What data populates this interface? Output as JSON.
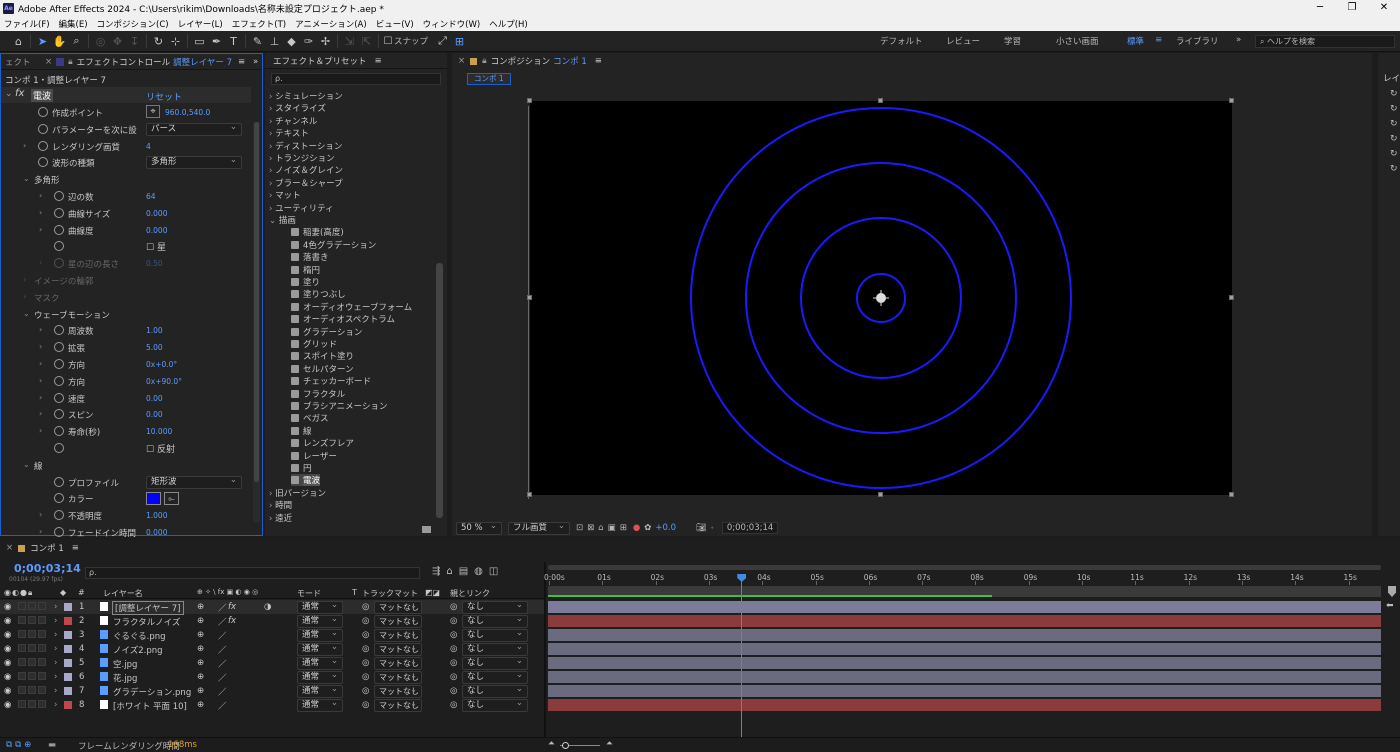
{
  "window": {
    "title": "Adobe After Effects 2024 - C:\\Users\\rikim\\Downloads\\名称未設定プロジェクト.aep *",
    "minimize": "─",
    "maximize": "❐",
    "close": "✕"
  },
  "menu": [
    "ファイル(F)",
    "編集(E)",
    "コンポジション(C)",
    "レイヤー(L)",
    "エフェクト(T)",
    "アニメーション(A)",
    "ビュー(V)",
    "ウィンドウ(W)",
    "ヘルプ(H)"
  ],
  "toolbar": {
    "snap_label": "スナップ",
    "workspaces": [
      "デフォルト",
      "レビュー",
      "学習",
      "小さい画面",
      "標準",
      "ライブラリ"
    ],
    "active_workspace": "標準",
    "more": "»",
    "help_placeholder": "ヘルプを検索"
  },
  "effect_controls": {
    "left_tab": "ェクト",
    "tab_prefix": "エフェクトコントロール",
    "tab_layer": "調整レイヤー 7",
    "menu_icon": "≡",
    "more": "»",
    "breadcrumb": "コンポ 1・調整レイヤー 7",
    "effect_name": "電波",
    "reset": "リセット",
    "rows": [
      {
        "label": "作成ポイント",
        "value": "960.0,540.0"
      },
      {
        "label": "パラメーターを次に設",
        "dropdown": "パース"
      },
      {
        "label": "レンダリング画質",
        "value": "4"
      },
      {
        "label": "波形の種類",
        "dropdown": "多角形"
      },
      {
        "label": "多角形",
        "group": true
      },
      {
        "label": "辺の数",
        "value": "64"
      },
      {
        "label": "曲線サイズ",
        "value": "0.000"
      },
      {
        "label": "曲線度",
        "value": "0.000"
      },
      {
        "label": "",
        "checkbox": "星"
      },
      {
        "label": "星の辺の長さ",
        "value": "0.50",
        "disabled": true
      },
      {
        "label": "イメージの輪郭",
        "group": true,
        "disabled": true
      },
      {
        "label": "マスク",
        "group": true,
        "disabled": true
      },
      {
        "label": "ウェーブモーション",
        "group": true
      },
      {
        "label": "周波数",
        "value": "1.00"
      },
      {
        "label": "拡張",
        "value": "5.00"
      },
      {
        "label": "方向",
        "value": "0x+0.0°"
      },
      {
        "label": "方向",
        "value": "0x+90.0°"
      },
      {
        "label": "速度",
        "value": "0.00"
      },
      {
        "label": "スピン",
        "value": "0.00"
      },
      {
        "label": "寿命(秒)",
        "value": "10.000"
      },
      {
        "label": "",
        "checkbox": "反射"
      },
      {
        "label": "線",
        "group": true
      },
      {
        "label": "プロファイル",
        "dropdown": "矩形波"
      },
      {
        "label": "カラー",
        "color": "#0000ff"
      },
      {
        "label": "不透明度",
        "value": "1.000"
      },
      {
        "label": "フェードイン時間",
        "value": "0.000"
      }
    ]
  },
  "effects_presets": {
    "tab": "エフェクト＆プリセット",
    "menu_icon": "≡",
    "search_placeholder": "ρ.",
    "categories_before": [
      "シミュレーション",
      "スタイライズ",
      "チャンネル",
      "テキスト",
      "ディストーション",
      "トランジション",
      "ノイズ＆グレイン",
      "ブラー＆シャープ",
      "マット",
      "ユーティリティ"
    ],
    "open_category": "描画",
    "items": [
      "稲妻(高度)",
      "4色グラデーション",
      "落書き",
      "楕円",
      "塗り",
      "塗りつぶし",
      "オーディオウェーブフォーム",
      "オーディオスペクトラム",
      "グラデーション",
      "グリッド",
      "スポイト塗り",
      "セルパターン",
      "チェッカーボード",
      "フラクタル",
      "ブラシアニメーション",
      "ベガス",
      "線",
      "レンズフレア",
      "レーザー",
      "円",
      "電波"
    ],
    "selected_item": "電波",
    "categories_after": [
      "旧バージョン",
      "時間",
      "遠近"
    ]
  },
  "composition": {
    "tab_prefix": "コンポジション",
    "tab_name": "コンポ 1",
    "menu_icon": "≡",
    "subtab": "コンポ 1",
    "ring_color": "#1a1aff",
    "zoom": "50 %",
    "resolution": "フル画質",
    "exposure": "+0.0",
    "timecode": "0;00;03;14"
  },
  "timeline": {
    "tab": "コンポ 1",
    "menu_icon": "≡",
    "timecode": "0;00;03;14",
    "frame_info": "00104 (29.97 fps)",
    "search_placeholder": "ρ.",
    "col_num": "#",
    "col_layer_name": "レイヤー名",
    "col_switches": "⊕ ✧ \\ fx ▣ ◐ ◉ ◎",
    "col_mode": "モード",
    "col_t": "T",
    "col_trackmatte": "トラックマット",
    "col_parent": "親とリンク",
    "ruler": [
      "0:00s",
      "01s",
      "02s",
      "03s",
      "04s",
      "05s",
      "06s",
      "07s",
      "08s",
      "09s",
      "10s",
      "11s",
      "12s",
      "13s",
      "14s",
      "15s"
    ],
    "playhead_fraction": 0.232,
    "work_area_fraction": 0.533,
    "layers": [
      {
        "num": "1",
        "name": "[調整レイヤー 7]",
        "label": "#a8a8c8",
        "mode": "通常",
        "matte": "マットなし",
        "parent": "なし",
        "bar": "#7b7b9a",
        "fx": true
      },
      {
        "num": "2",
        "name": "フラクタルノイズ",
        "label": "#c04848",
        "mode": "通常",
        "matte": "マットなし",
        "parent": "なし",
        "bar": "#8a3c3c",
        "fx": true
      },
      {
        "num": "3",
        "name": "ぐるぐる.png",
        "label": "#a8a8c8",
        "mode": "通常",
        "matte": "マットなし",
        "parent": "なし",
        "bar": "#6b6b80",
        "fx": false
      },
      {
        "num": "4",
        "name": "ノイズ2.png",
        "label": "#a8a8c8",
        "mode": "通常",
        "matte": "マットなし",
        "parent": "なし",
        "bar": "#6b6b80",
        "fx": false
      },
      {
        "num": "5",
        "name": "空.jpg",
        "label": "#a8a8c8",
        "mode": "通常",
        "matte": "マットなし",
        "parent": "なし",
        "bar": "#6b6b80",
        "fx": false
      },
      {
        "num": "6",
        "name": "花.jpg",
        "label": "#a8a8c8",
        "mode": "通常",
        "matte": "マットなし",
        "parent": "なし",
        "bar": "#6b6b80",
        "fx": false
      },
      {
        "num": "7",
        "name": "グラデーション.png",
        "label": "#a8a8c8",
        "mode": "通常",
        "matte": "マットなし",
        "parent": "なし",
        "bar": "#6b6b80",
        "fx": false
      },
      {
        "num": "8",
        "name": "[ホワイト 平面 10]",
        "label": "#c04848",
        "mode": "通常",
        "matte": "マットなし",
        "parent": "なし",
        "bar": "#8a3c3c",
        "fx": false
      }
    ],
    "footer_label": "フレームレンダリング時間",
    "footer_value": "168ms"
  }
}
